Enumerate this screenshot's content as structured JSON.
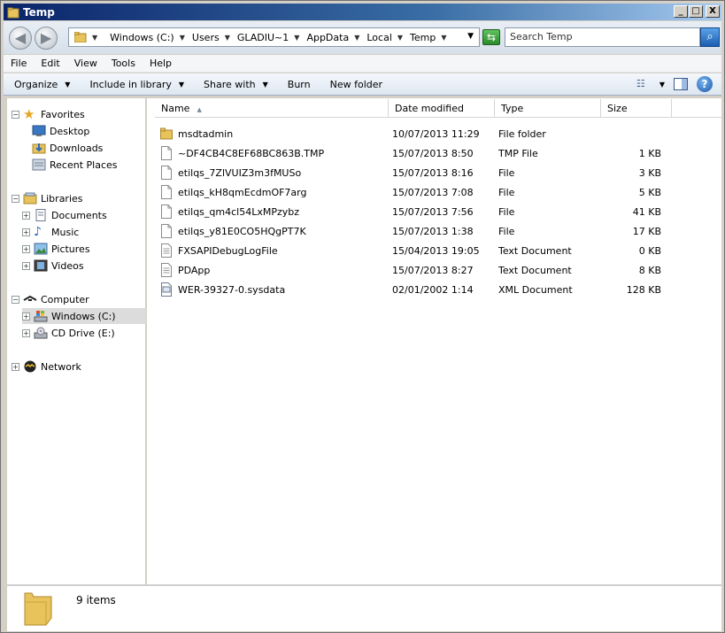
{
  "window": {
    "title": "Temp",
    "controls": {
      "minimize": "_",
      "maximize": "□",
      "close": "X"
    }
  },
  "address": {
    "crumbs": [
      "Windows (C:)",
      "Users",
      "GLADIU~1",
      "AppData",
      "Local",
      "Temp"
    ],
    "search_placeholder": "Search Temp"
  },
  "menu": [
    "File",
    "Edit",
    "View",
    "Tools",
    "Help"
  ],
  "commands": {
    "organize": "Organize",
    "include_in_library": "Include in library",
    "share_with": "Share with",
    "burn": "Burn",
    "new_folder": "New folder"
  },
  "nav": {
    "favorites": "Favorites",
    "desktop": "Desktop",
    "downloads": "Downloads",
    "recent_places": "Recent Places",
    "libraries": "Libraries",
    "documents": "Documents",
    "music": "Music",
    "pictures": "Pictures",
    "videos": "Videos",
    "computer": "Computer",
    "windows_c": "Windows (C:)",
    "cd_drive": "CD Drive (E:)",
    "network": "Network"
  },
  "columns": {
    "name": "Name",
    "date": "Date modified",
    "type": "Type",
    "size": "Size"
  },
  "files": [
    {
      "name": "msdtadmin",
      "date": "10/07/2013 11:29",
      "type": "File folder",
      "size": "",
      "icon": "folder-icon"
    },
    {
      "name": "~DF4CB4C8EF68BC863B.TMP",
      "date": "15/07/2013 8:50",
      "type": "TMP File",
      "size": "1 KB",
      "icon": "file-icon"
    },
    {
      "name": "etilqs_7ZlVUIZ3m3fMUSo",
      "date": "15/07/2013 8:16",
      "type": "File",
      "size": "3 KB",
      "icon": "file-icon"
    },
    {
      "name": "etilqs_kH8qmEcdmOF7arg",
      "date": "15/07/2013 7:08",
      "type": "File",
      "size": "5 KB",
      "icon": "file-icon"
    },
    {
      "name": "etilqs_qm4cl54LxMPzybz",
      "date": "15/07/2013 7:56",
      "type": "File",
      "size": "41 KB",
      "icon": "file-icon"
    },
    {
      "name": "etilqs_y81E0CO5HQgPT7K",
      "date": "15/07/2013 1:38",
      "type": "File",
      "size": "17 KB",
      "icon": "file-icon"
    },
    {
      "name": "FXSAPIDebugLogFile",
      "date": "15/04/2013 19:05",
      "type": "Text Document",
      "size": "0 KB",
      "icon": "text-document-icon"
    },
    {
      "name": "PDApp",
      "date": "15/07/2013 8:27",
      "type": "Text Document",
      "size": "8 KB",
      "icon": "text-document-icon"
    },
    {
      "name": "WER-39327-0.sysdata",
      "date": "02/01/2002 1:14",
      "type": "XML Document",
      "size": "128 KB",
      "icon": "xml-document-icon"
    }
  ],
  "details": {
    "item_count": "9 items"
  },
  "colors": {
    "title_bar": "#0a246a",
    "selected_nav": "#dcdcdc",
    "folder": "#e8c25a"
  }
}
